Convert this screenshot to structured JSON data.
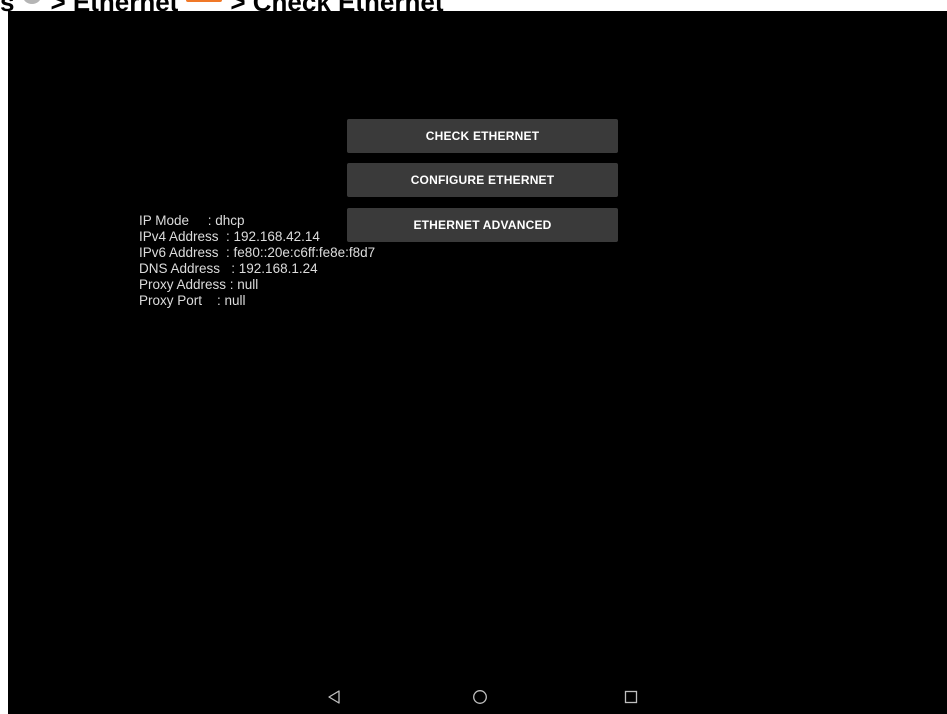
{
  "heading": {
    "prefix": "s",
    "ethernet_part": "> Ethernet",
    "check_part": "> Check Ethernet"
  },
  "buttons": {
    "check_ethernet": "CHECK ETHERNET",
    "configure_ethernet": "CONFIGURE ETHERNET",
    "ethernet_advanced": "ETHERNET ADVANCED"
  },
  "info": {
    "ip_mode": "IP Mode     : dhcp",
    "ipv4": "IPv4 Address  : 192.168.42.14",
    "ipv6": "IPv6 Address  : fe80::20e:c6ff:fe8e:f8d7",
    "dns": "DNS Address   : 192.168.1.24",
    "proxy_address": "Proxy Address : null",
    "proxy_port": "Proxy Port    : null"
  },
  "navbar": {
    "back_icon": "back-triangle-icon",
    "home_icon": "home-circle-icon",
    "recents_icon": "recents-square-icon",
    "icon_color": "#bfbfbf"
  },
  "colors": {
    "screen_bg": "#000000",
    "button_bg": "#3a3a3a",
    "text": "#dcdcdc",
    "ethernet_icon": "#f07828"
  }
}
